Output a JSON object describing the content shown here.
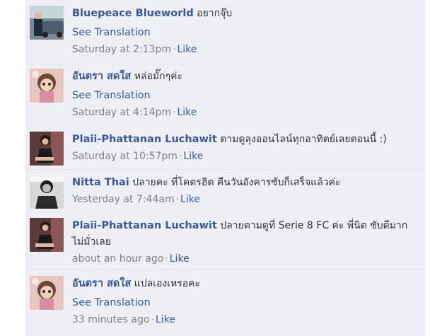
{
  "comments": [
    {
      "author": "Bluepeace Blueworld",
      "text": "อยากจุ๊บ",
      "translate": "See Translation",
      "time": "Saturday at 2:13pm",
      "like": "Like",
      "avatar": "man-with-car-photo"
    },
    {
      "author": "อันตรา สดใส",
      "text": "หล่อมั๊กๆค่ะ",
      "translate": "See Translation",
      "time": "Saturday at 4:14pm",
      "like": "Like",
      "avatar": "doll-photo"
    },
    {
      "author": "Plaii-Phattanan Luchawit",
      "text": "ตามดูลุงออนไลน์ทุกอาทิตย์เลยตอนนี้ :)",
      "time": "Saturday at 10:57pm",
      "like": "Like",
      "avatar": "woman-seated-photo"
    },
    {
      "author": "Nitta Thai",
      "text": "ปลายคะ ที่โคตรฮิต คืนวันอังคารซับก็เสร็จแล้วค่ะ",
      "time": "Yesterday at 7:44am",
      "like": "Like",
      "avatar": "woman-bw-photo"
    },
    {
      "author": "Plaii-Phattanan Luchawit",
      "text": "ปลายตามดูที่ Serie 8 FC ค่ะ พี่นิต ซับดีมาก",
      "text2": "ไม่มั่วเลย",
      "time": "about an hour ago",
      "like": "Like",
      "avatar": "woman-seated-photo"
    },
    {
      "author": "อันตรา สดใส",
      "text": "แปลเองเหรอคะ",
      "translate": "See Translation",
      "time": "33 minutes ago",
      "like": "Like",
      "avatar": "doll-photo"
    }
  ],
  "colors": {
    "panel": "#edeff4",
    "link": "#3b5998",
    "meta": "#808080"
  }
}
